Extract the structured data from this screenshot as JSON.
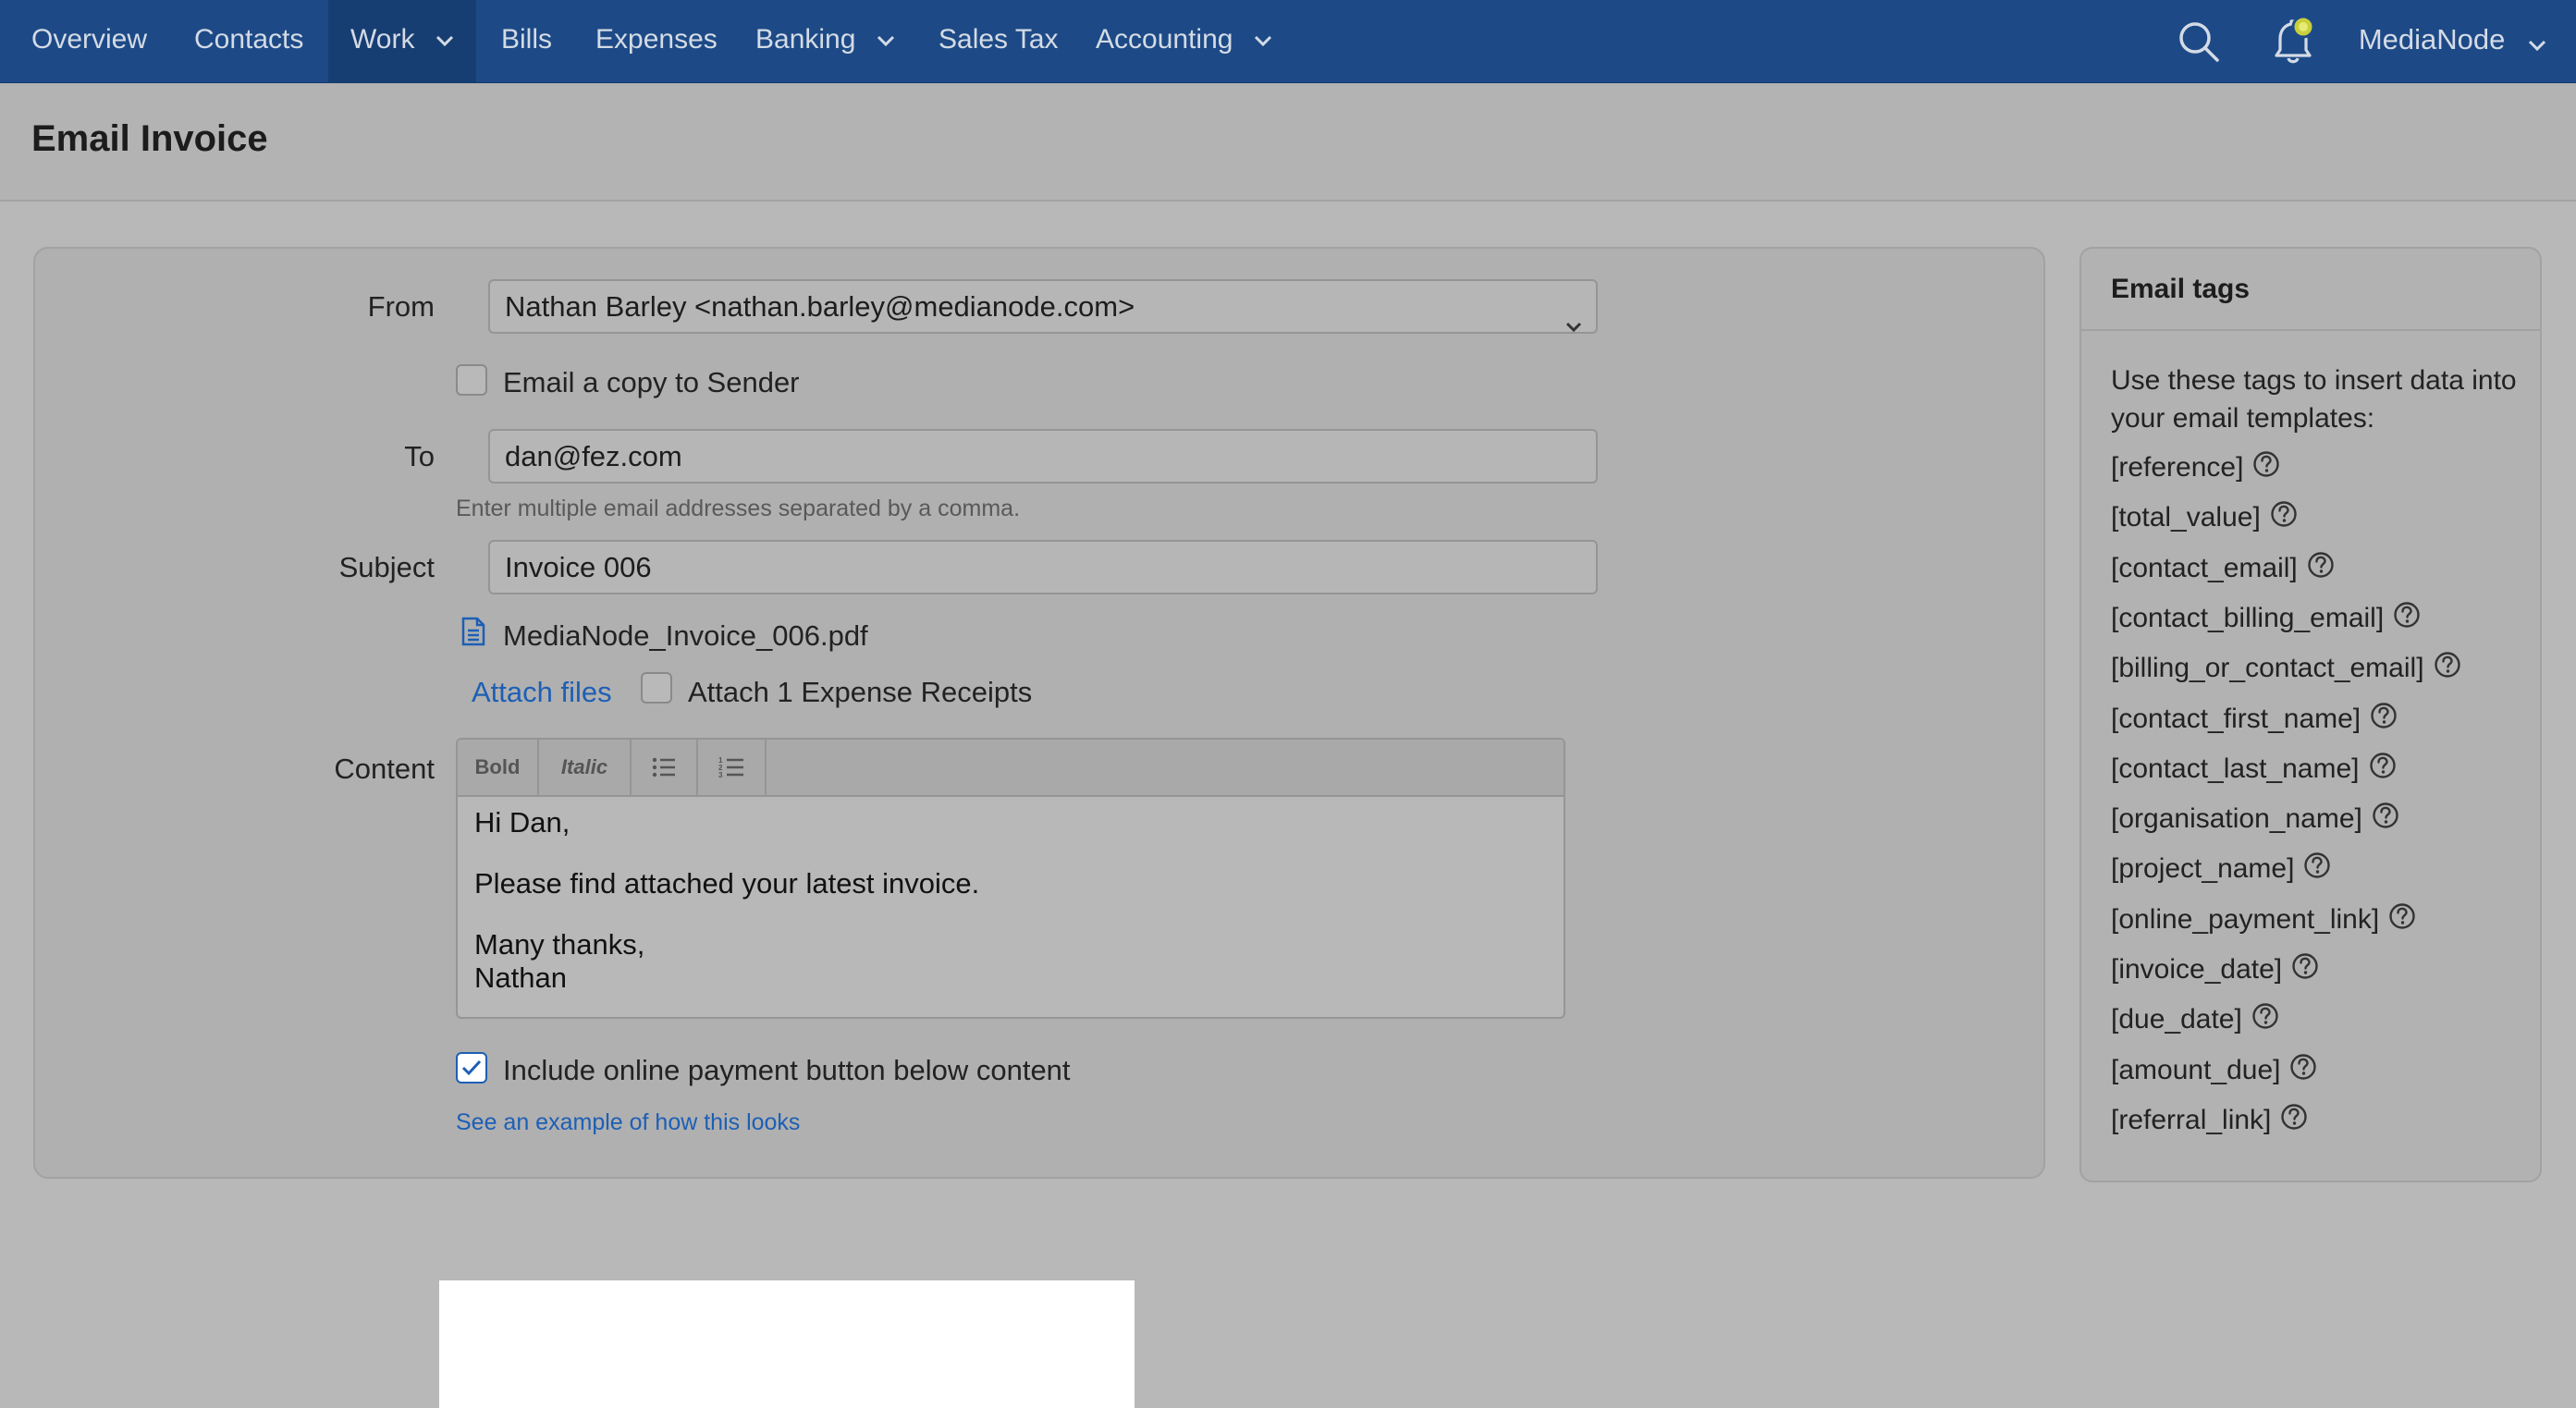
{
  "nav": {
    "items": [
      {
        "label": "Overview"
      },
      {
        "label": "Contacts"
      },
      {
        "label": "Work"
      },
      {
        "label": "Bills"
      },
      {
        "label": "Expenses"
      },
      {
        "label": "Banking"
      },
      {
        "label": "Sales Tax"
      },
      {
        "label": "Accounting"
      }
    ],
    "active": "Work",
    "account": "MediaNode",
    "search_icon": "search-icon",
    "bell_icon": "bell-icon"
  },
  "page": {
    "title": "Email Invoice"
  },
  "form": {
    "from_label": "From",
    "from_value": "Nathan Barley <nathan.barley@medianode.com>",
    "copy_sender_label": "Email a copy to Sender",
    "copy_sender_checked": false,
    "to_label": "To",
    "to_value": "dan@fez.com",
    "to_hint": "Enter multiple email addresses separated by a comma.",
    "subject_label": "Subject",
    "subject_value": "Invoice 006",
    "attachment_name": "MediaNode_Invoice_006.pdf",
    "attach_files_link": "Attach files",
    "attach_receipts_label": "Attach 1 Expense Receipts",
    "attach_receipts_checked": false,
    "content_label": "Content",
    "toolbar": {
      "bold": "Bold",
      "italic": "Italic"
    },
    "content": {
      "greeting": "Hi Dan,",
      "body": "Please find attached your latest invoice.",
      "signoff": "Many thanks,",
      "name": "Nathan"
    },
    "payment_button_label": "Include online payment button below content",
    "payment_button_checked": true,
    "example_link": "See an example of how this looks"
  },
  "email_tags": {
    "title": "Email tags",
    "description": "Use these tags to insert data into your email templates:",
    "tags": [
      "[reference]",
      "[total_value]",
      "[contact_email]",
      "[contact_billing_email]",
      "[billing_or_contact_email]",
      "[contact_first_name]",
      "[contact_last_name]",
      "[organisation_name]",
      "[project_name]",
      "[online_payment_link]",
      "[invoice_date]",
      "[due_date]",
      "[amount_due]",
      "[referral_link]"
    ]
  },
  "colors": {
    "nav_bg": "#1d4a87",
    "link": "#1d5fb5",
    "highlight": "#ffffff"
  }
}
